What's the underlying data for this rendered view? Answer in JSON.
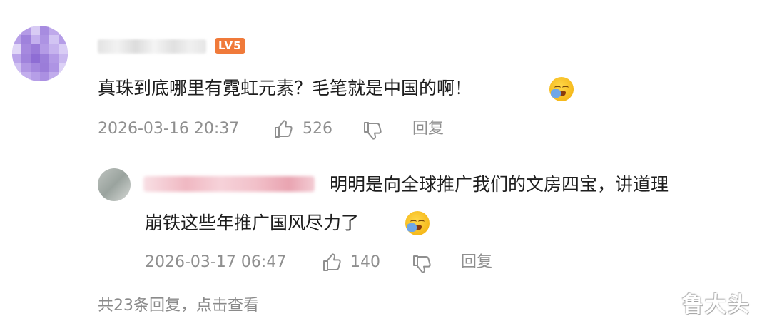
{
  "comment": {
    "level_badge": "LV5",
    "text": "真珠到底哪里有霓虹元素？毛笔就是中国的啊！",
    "timestamp": "2026-03-16 20:37",
    "like_count": "526",
    "reply_label": "回复",
    "emoji_icon": "facepalm-cry-emoji"
  },
  "reply": {
    "text_line1": "明明是向全球推广我们的文房四宝，讲道理",
    "text_line2": "崩铁这些年推广国风尽力了",
    "timestamp": "2026-03-17 06:47",
    "like_count": "140",
    "reply_label": "回复",
    "emoji_icon": "facepalm-cry-emoji"
  },
  "footer": {
    "view_replies": "共23条回复，点击查看"
  },
  "watermark": "鲁大头",
  "colors": {
    "text": "#1e1e1e",
    "meta": "#8f8f8f",
    "badge": "#f07a3a",
    "avatar_main": "#b9a4e8"
  }
}
